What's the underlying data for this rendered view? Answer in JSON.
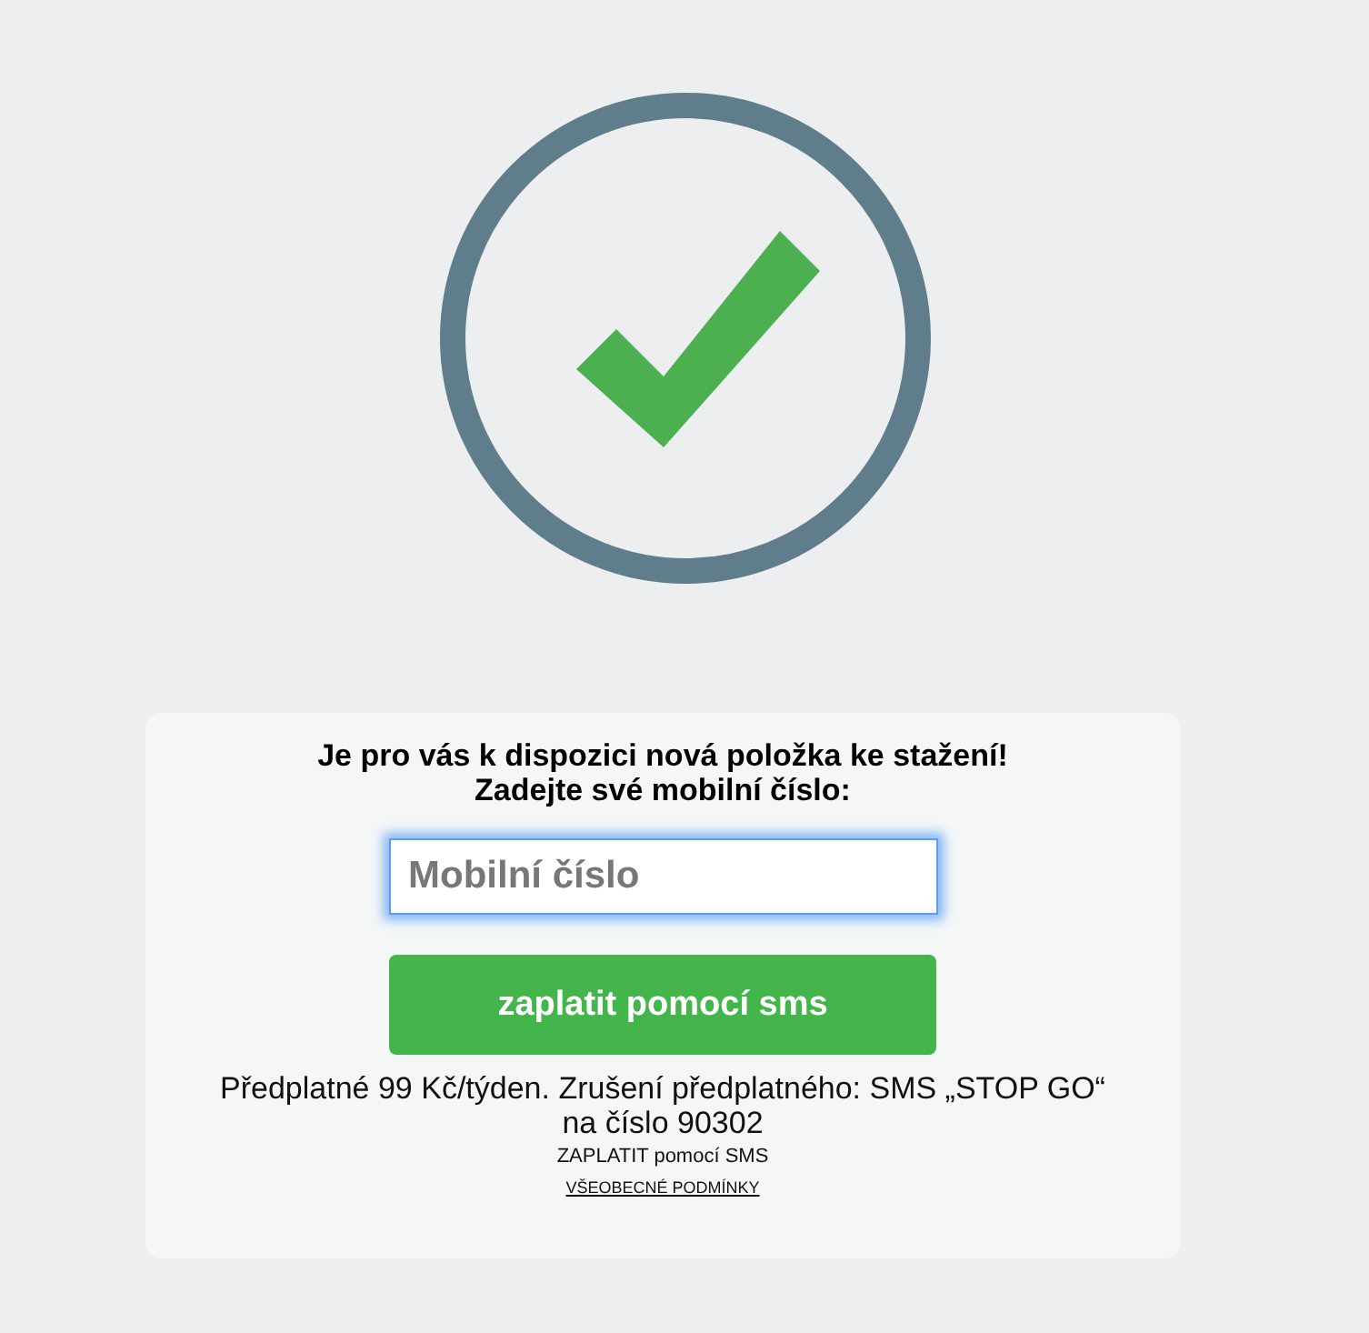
{
  "heading": [
    "Je pro vás k dispozici nová položka ke stažení!",
    "Zadejte své mobilní číslo:"
  ],
  "phone_field": {
    "placeholder": "Mobilní číslo",
    "focused": true
  },
  "pay_button": "zaplatit pomocí sms",
  "terms": [
    "Předplatné 99 Kč/týden. Zrušení předplatného: SMS „STOP GO“",
    "na číslo 90302"
  ],
  "note": "ZAPLATIT pomocí SMS",
  "conditions_link": "VŠEOBECNÉ PODMÍNKY"
}
